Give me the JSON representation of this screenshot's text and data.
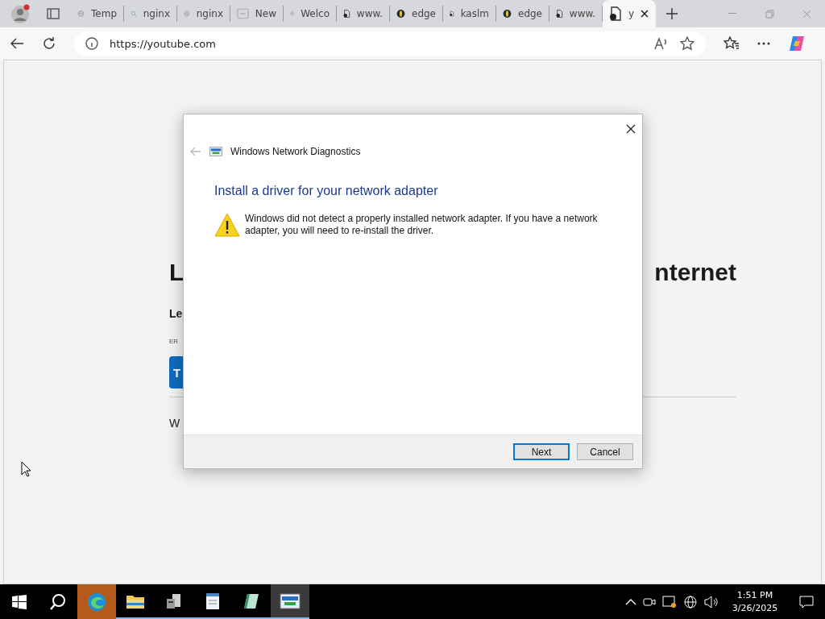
{
  "browser": {
    "tabs": [
      {
        "kind": "globe",
        "label": "Temp",
        "selected": false
      },
      {
        "kind": "search",
        "label": "nginx",
        "selected": false
      },
      {
        "kind": "globe",
        "label": "nginx",
        "selected": false
      },
      {
        "kind": "blank",
        "label": "New",
        "selected": false
      },
      {
        "kind": "globe",
        "label": "Welco",
        "selected": false
      },
      {
        "kind": "doc",
        "label": "www.",
        "selected": false
      },
      {
        "kind": "oval",
        "label": "edge",
        "selected": false
      },
      {
        "kind": "doc",
        "label": "kaslm",
        "selected": false
      },
      {
        "kind": "oval",
        "label": "edge",
        "selected": false
      },
      {
        "kind": "doc",
        "label": "www.",
        "selected": false
      },
      {
        "kind": "doc",
        "label": "y",
        "selected": true
      }
    ],
    "address": "https://youtube.com"
  },
  "page": {
    "heading_start": "L",
    "heading_end": "nternet",
    "subheading": "Le",
    "error_code": "ER",
    "button": "T",
    "footer_text": "W"
  },
  "dialog": {
    "title": "Windows Network Diagnostics",
    "back_disabled": true,
    "heading": "Install a driver for your network adapter",
    "message": "Windows did not detect a properly installed network adapter. If you have a network adapter, you will need to re-install the driver.",
    "buttons": [
      {
        "label": "Next",
        "default": true
      },
      {
        "label": "Cancel",
        "default": false
      }
    ]
  },
  "taskbar": {
    "apps": [
      {
        "kind": "edge",
        "attention": true,
        "open": false,
        "selected": false
      },
      {
        "kind": "folder",
        "attention": false,
        "open": true,
        "selected": false
      },
      {
        "kind": "server",
        "attention": false,
        "open": true,
        "selected": false
      },
      {
        "kind": "notepad",
        "attention": false,
        "open": true,
        "selected": false
      },
      {
        "kind": "book",
        "attention": false,
        "open": true,
        "selected": false
      },
      {
        "kind": "diagnostics",
        "attention": false,
        "open": true,
        "selected": true
      }
    ],
    "time": "1:51 PM",
    "date": "3/26/2025"
  }
}
